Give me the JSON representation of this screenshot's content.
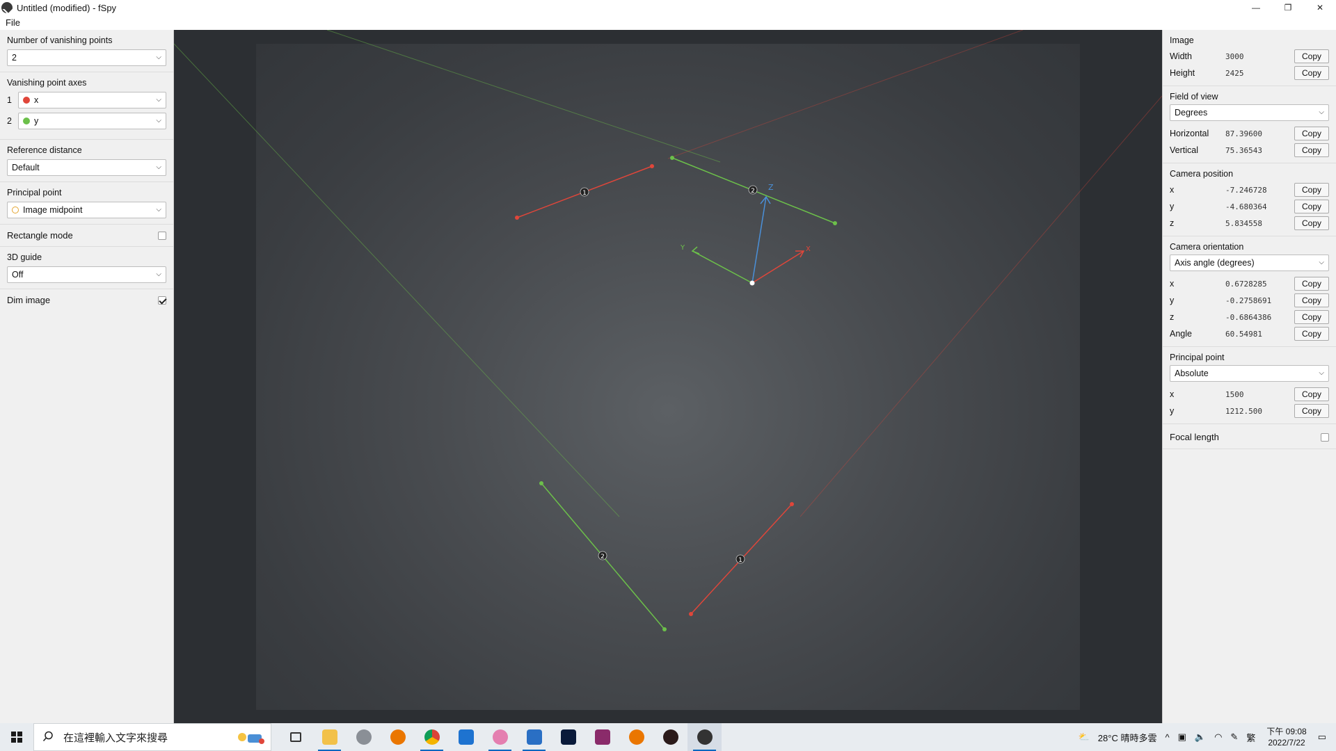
{
  "window": {
    "title": "Untitled (modified) - fSpy",
    "controls": {
      "minimize": "—",
      "maximize": "❐",
      "close": "✕"
    }
  },
  "menu": {
    "file": "File"
  },
  "left": {
    "vp_count": {
      "title": "Number of vanishing points",
      "value": "2"
    },
    "vp_axes": {
      "title": "Vanishing point axes",
      "items": [
        {
          "num": "1",
          "label": "x",
          "color": "#e0463a"
        },
        {
          "num": "2",
          "label": "y",
          "color": "#6cc04a"
        }
      ]
    },
    "ref_distance": {
      "title": "Reference distance",
      "value": "Default"
    },
    "principal_point": {
      "title": "Principal point",
      "value": "Image midpoint"
    },
    "rect_mode": {
      "label": "Rectangle mode",
      "checked": false
    },
    "guide": {
      "title": "3D guide",
      "value": "Off"
    },
    "dim_image": {
      "label": "Dim image",
      "checked": true
    }
  },
  "right": {
    "image": {
      "title": "Image",
      "rows": [
        {
          "label": "Width",
          "value": "3000"
        },
        {
          "label": "Height",
          "value": "2425"
        }
      ]
    },
    "fov": {
      "title": "Field of view",
      "select": "Degrees",
      "rows": [
        {
          "label": "Horizontal",
          "value": "87.39600"
        },
        {
          "label": "Vertical",
          "value": "75.36543"
        }
      ]
    },
    "cam_pos": {
      "title": "Camera position",
      "rows": [
        {
          "label": "x",
          "value": "-7.246728"
        },
        {
          "label": "y",
          "value": "-4.680364"
        },
        {
          "label": "z",
          "value": "5.834558"
        }
      ]
    },
    "cam_orient": {
      "title": "Camera orientation",
      "select": "Axis angle (degrees)",
      "rows": [
        {
          "label": "x",
          "value": "0.6728285"
        },
        {
          "label": "y",
          "value": "-0.2758691"
        },
        {
          "label": "z",
          "value": "-0.6864386"
        },
        {
          "label": "Angle",
          "value": "60.54981"
        }
      ]
    },
    "pp": {
      "title": "Principal point",
      "select": "Absolute",
      "rows": [
        {
          "label": "x",
          "value": "1500"
        },
        {
          "label": "y",
          "value": "1212.500"
        }
      ]
    },
    "focal": {
      "label": "Focal length"
    },
    "copy_label": "Copy"
  },
  "overlay": {
    "handle_labels": {
      "vp1": "1",
      "vp2": "2"
    },
    "axis_labels": {
      "x": "X",
      "y": "Y",
      "z": "Z"
    },
    "colors": {
      "x": "#e0463a",
      "y": "#6cc04a",
      "z": "#4a90d9"
    }
  },
  "taskbar": {
    "search_placeholder": "在這裡輸入文字來搜尋",
    "weather": "28°C  晴時多雲",
    "lang": "繁",
    "time": "下午 09:08",
    "date": "2022/7/22"
  }
}
